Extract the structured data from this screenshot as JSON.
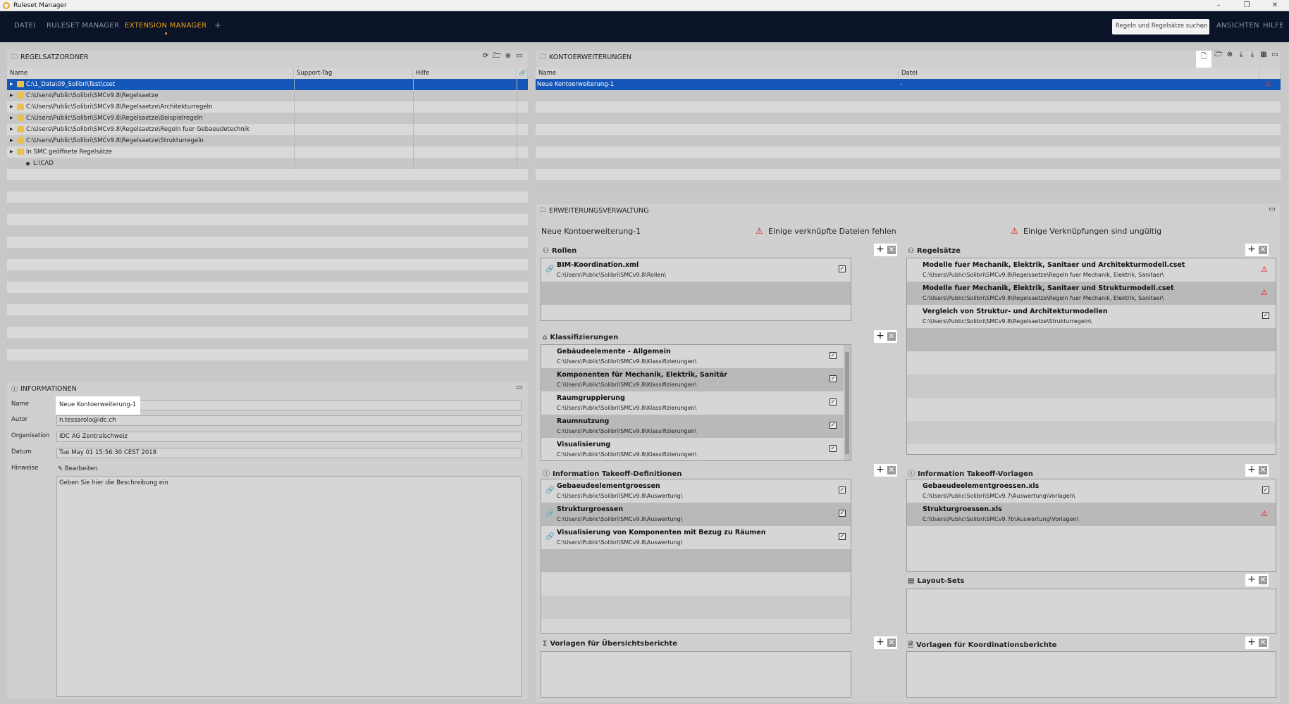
{
  "app": {
    "title": "Ruleset Manager",
    "window_buttons": [
      "–",
      "❐",
      "✕"
    ]
  },
  "menu": {
    "items": [
      "DATEI",
      "RULESET MANAGER",
      "EXTENSION MANAGER"
    ],
    "add": "+",
    "search_placeholder": "Regeln und Regelsätze suchen",
    "right": [
      "ANSICHTEN",
      "HILFE"
    ]
  },
  "folders": {
    "title": "REGELSATZORDNER",
    "columns": [
      "Name",
      "Support-Tag",
      "Hilfe"
    ],
    "rows": [
      "C:\\1_Data\\09_Solibri\\Test\\cset",
      "C:\\Users\\Public\\Solibri\\SMCv9.8\\Regelsaetze",
      "C:\\Users\\Public\\Solibri\\SMCv9.8\\Regelsaetze\\Architekturregeln",
      "C:\\Users\\Public\\Solibri\\SMCv9.8\\Regelsaetze\\Beispielregeln",
      "C:\\Users\\Public\\Solibri\\SMCv9.8\\Regelsaetze\\Regeln fuer Gebaeudetechnik",
      "C:\\Users\\Public\\Solibri\\SMCv9.8\\Regelsaetze\\Strukturregeln",
      "In SMC geöffnete Regelsätze",
      "L:\\CAD"
    ]
  },
  "info": {
    "title": "INFORMATIONEN",
    "labels": {
      "name": "Name",
      "author": "Autor",
      "org": "Organisation",
      "date": "Datum",
      "notes": "Hinweise"
    },
    "values": {
      "name": "Neue Kontoerweiterung-1",
      "author": "n.tessarolo@idc.ch",
      "org": "IDC AG Zentralschweiz",
      "date": "Tue May 01 15:56:30 CEST 2018"
    },
    "edit": "Bearbeiten",
    "description": "Geben Sie hier die Beschreibung ein"
  },
  "extensions": {
    "title": "KONTOERWEITERUNGEN",
    "columns": [
      "Name",
      "Datei"
    ],
    "rows": [
      {
        "name": "Neue Kontoerweiterung-1",
        "file": "-"
      }
    ]
  },
  "mgmt": {
    "title": "ERWEITERUNGSVERWALTUNG",
    "ext_name": "Neue Kontoerweiterung-1",
    "warn1": "Einige verknüpfte Dateien fehlen",
    "warn2": "Einige Verknüpfungen sind ungültig",
    "roles": {
      "title": "Rollen",
      "items": [
        {
          "name": "BIM-Koordination.xml",
          "path": "C:\\Users\\Public\\Solibri\\SMCv9.8\\Rollen\\"
        }
      ]
    },
    "rulesets": {
      "title": "Regelsätze",
      "items": [
        {
          "name": "Modelle fuer Mechanik, Elektrik, Sanitaer und Architekturmodell.cset",
          "path": "C:\\Users\\Public\\Solibri\\SMCv9.8\\Regelsaetze\\Regeln fuer Mechanik, Elektrik, Sanitaer\\"
        },
        {
          "name": "Modelle fuer Mechanik, Elektrik, Sanitaer und Strukturmodell.cset",
          "path": "C:\\Users\\Public\\Solibri\\SMCv9.8\\Regelsaetze\\Regeln fuer Mechanik, Elektrik, Sanitaer\\"
        },
        {
          "name": "Vergleich von Struktur- und Architekturmodellen",
          "path": "C:\\Users\\Public\\Solibri\\SMCv9.8\\Regelsaetze\\Strukturregeln\\"
        }
      ]
    },
    "classifications": {
      "title": "Klassifizierungen",
      "items": [
        {
          "name": "Gebäudeelemente - Allgemein",
          "path": "C:\\Users\\Public\\Solibri\\SMCv9.8\\Klassifizierungen\\"
        },
        {
          "name": "Komponenten für Mechanik, Elektrik, Sanitär",
          "path": "C:\\Users\\Public\\Solibri\\SMCv9.8\\Klassifizierungen\\"
        },
        {
          "name": "Raumgruppierung",
          "path": "C:\\Users\\Public\\Solibri\\SMCv9.8\\Klassifizierungen\\"
        },
        {
          "name": "Raumnutzung",
          "path": "C:\\Users\\Public\\Solibri\\SMCv9.8\\Klassifizierungen\\"
        },
        {
          "name": "Visualisierung",
          "path": "C:\\Users\\Public\\Solibri\\SMCv9.8\\Klassifizierungen\\"
        }
      ]
    },
    "ito_defs": {
      "title": "Information Takeoff-Definitionen",
      "items": [
        {
          "name": "Gebaeudeelementgroessen",
          "path": "C:\\Users\\Public\\Solibri\\SMCv9.8\\Auswertung\\"
        },
        {
          "name": "Strukturgroessen",
          "path": "C:\\Users\\Public\\Solibri\\SMCv9.8\\Auswertung\\"
        },
        {
          "name": "Visualisierung von Komponenten mit Bezug zu Räumen",
          "path": "C:\\Users\\Public\\Solibri\\SMCv9.8\\Auswertung\\"
        }
      ]
    },
    "ito_templates": {
      "title": "Information Takeoff-Vorlagen",
      "items": [
        {
          "name": "Gebaeudeelementgroessen.xls",
          "path": "C:\\Users\\Public\\Solibri\\SMCv9.7\\Auswertung\\Vorlagen\\"
        },
        {
          "name": "Strukturgroessen.xls",
          "path": "C:\\Users\\Public\\Solibri\\SMCv9.7b\\Auswertung\\Vorlagen\\"
        }
      ]
    },
    "layout_sets": {
      "title": "Layout-Sets"
    },
    "overview_reports": {
      "title": "Vorlagen für Übersichtsberichte"
    },
    "coord_reports": {
      "title": "Vorlagen für Koordinationsberichte"
    }
  }
}
